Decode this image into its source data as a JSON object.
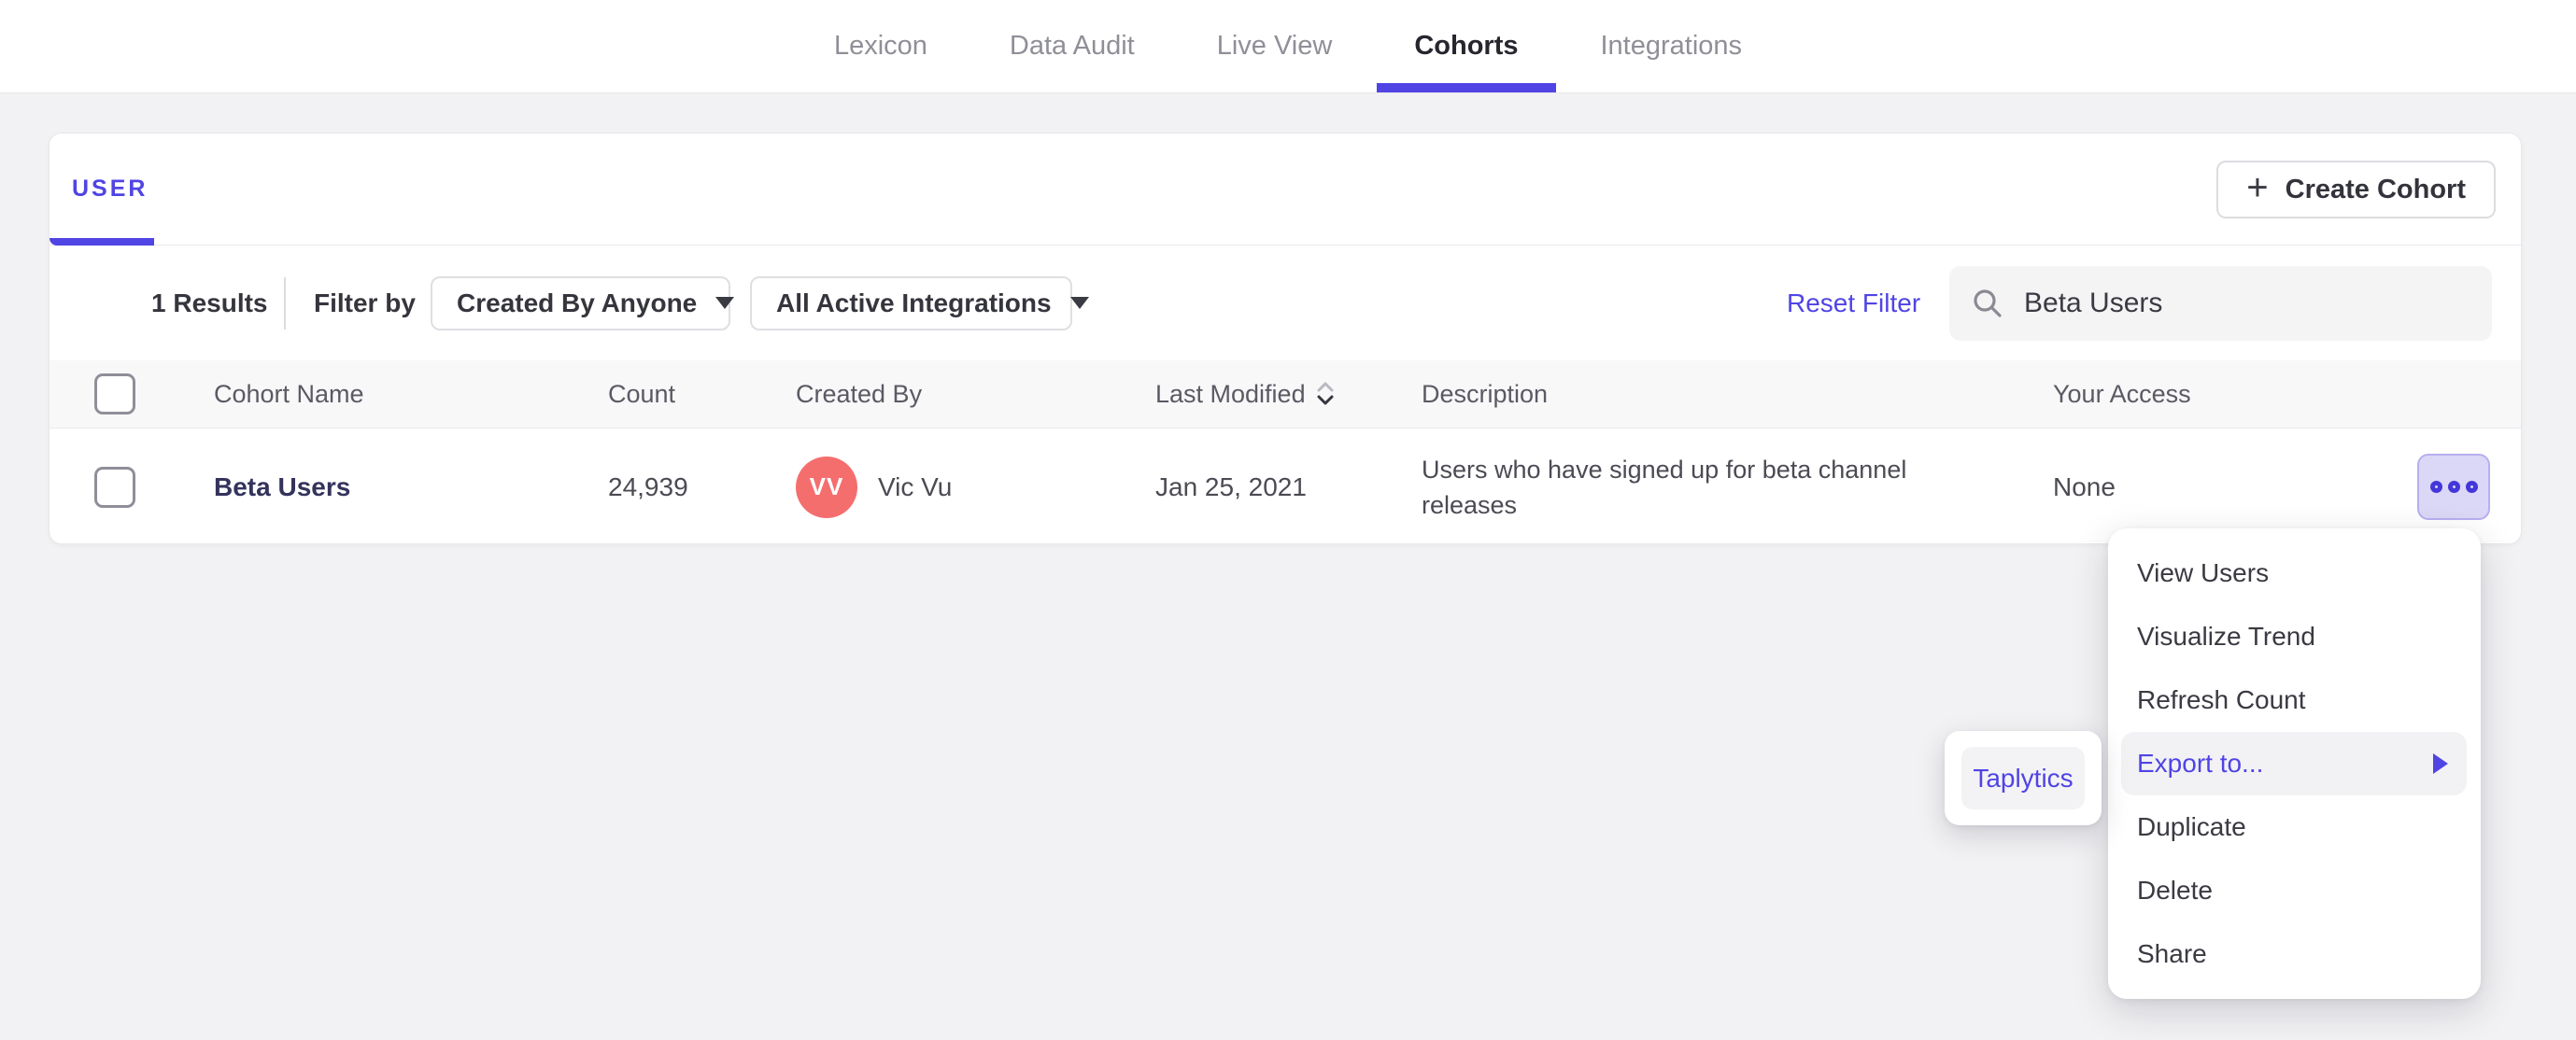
{
  "nav": {
    "tabs": [
      {
        "label": "Lexicon",
        "active": false
      },
      {
        "label": "Data Audit",
        "active": false
      },
      {
        "label": "Live View",
        "active": false
      },
      {
        "label": "Cohorts",
        "active": true
      },
      {
        "label": "Integrations",
        "active": false
      }
    ]
  },
  "panel": {
    "tab_label": "USER",
    "create_button_label": "Create Cohort",
    "create_button_plus": "+",
    "filter_bar": {
      "results_count": "1 Results",
      "filter_by_label": "Filter by",
      "created_by_dropdown_value": "Created By Anyone",
      "integrations_dropdown_value": "All Active Integrations",
      "reset_filter_label": "Reset Filter",
      "search_value": "Beta Users"
    },
    "table": {
      "columns": {
        "name": "Cohort Name",
        "count": "Count",
        "created_by": "Created By",
        "last_modified": "Last Modified",
        "description": "Description",
        "your_access": "Your Access"
      },
      "row": {
        "name": "Beta Users",
        "count": "24,939",
        "created_by_initials": "VV",
        "created_by_name": "Vic Vu",
        "last_modified": "Jan 25, 2021",
        "description": "Users who have signed up for beta channel releases",
        "your_access": "None"
      }
    }
  },
  "context_menu": {
    "items": [
      {
        "label": "View Users"
      },
      {
        "label": "Visualize Trend"
      },
      {
        "label": "Refresh Count"
      },
      {
        "label": "Export to...",
        "highlighted": true,
        "has_submenu": true
      },
      {
        "label": "Duplicate"
      },
      {
        "label": "Delete"
      },
      {
        "label": "Share"
      }
    ]
  },
  "export_submenu": {
    "items": [
      {
        "label": "Taplytics"
      }
    ]
  },
  "colors": {
    "accent_purple": "#5044e4",
    "avatar_coral": "#f56e6e",
    "page_background": "#f2f2f4",
    "more_button_fill": "#dbd7f6"
  }
}
